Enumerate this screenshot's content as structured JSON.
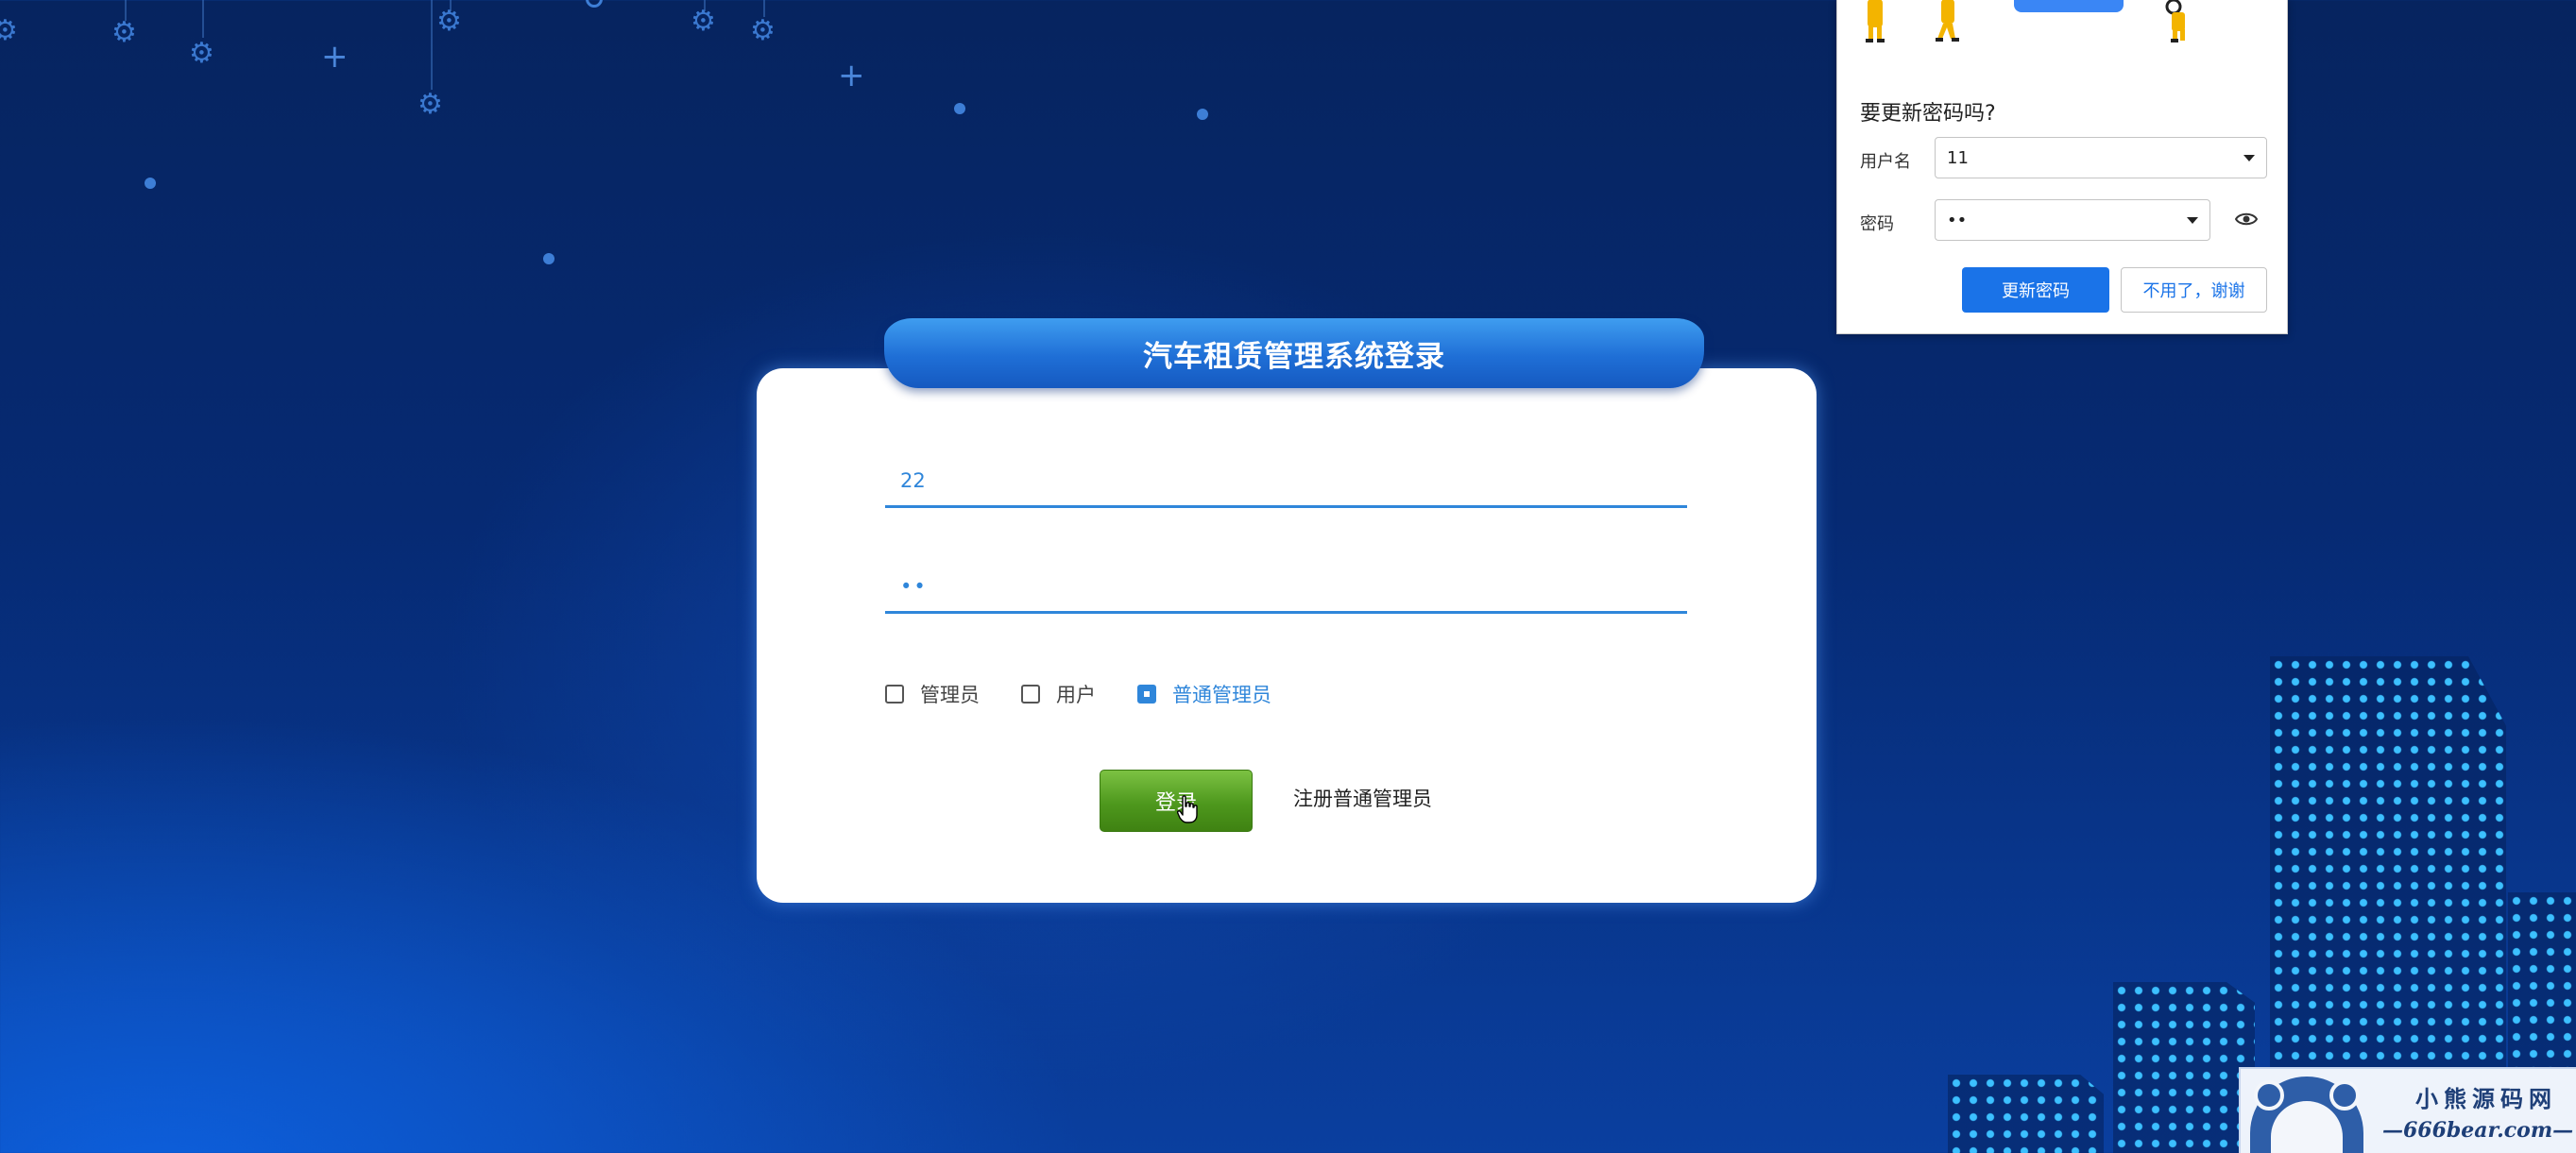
{
  "login": {
    "title": "汽车租赁管理系统登录",
    "username_value": "22",
    "password_value": "••",
    "roles": [
      {
        "label": "管理员",
        "checked": false
      },
      {
        "label": "用户",
        "checked": false
      },
      {
        "label": "普通管理员",
        "checked": true
      }
    ],
    "login_label": "登录",
    "register_label": "注册普通管理员"
  },
  "password_prompt": {
    "question": "要更新密码吗?",
    "username_label": "用户名",
    "username_value": "11",
    "password_label": "密码",
    "password_value": "••",
    "update_label": "更新密码",
    "decline_label": "不用了，谢谢"
  },
  "watermark": {
    "line1": "小熊源码网",
    "line2": "—666bear.com—"
  },
  "icons": {
    "eye": "eye-icon",
    "gear": "gear-icon",
    "cursor": "hand-cursor-icon"
  },
  "colors": {
    "accent": "#2f86da",
    "login_button": "#5aa726",
    "popup_primary": "#1a73e8"
  }
}
